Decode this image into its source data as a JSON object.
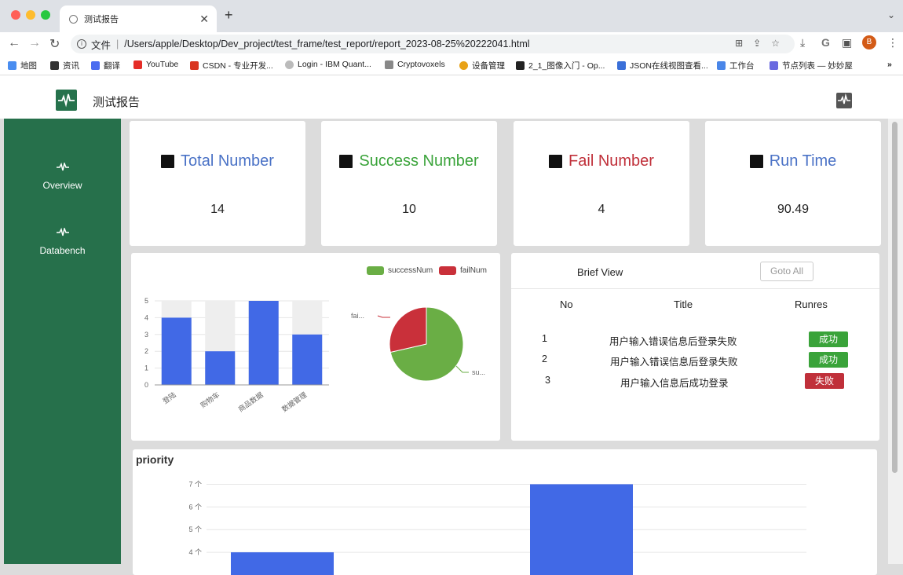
{
  "browser": {
    "tab_title": "测试报告",
    "url_prefix": "文件",
    "url": "/Users/apple/Desktop/Dev_project/test_frame/test_report/report_2023-08-25%20222041.html",
    "avatar_letter": "B",
    "bookmarks": [
      "地图",
      "资讯",
      "翻译",
      "YouTube",
      "CSDN - 专业开发...",
      "Login - IBM Quant...",
      "Cryptovoxels",
      "设备管理",
      "2_1_图像入门 - Op...",
      "JSON在线视图查看...",
      "工作台",
      "节点列表 — 妙妙屋"
    ]
  },
  "header": {
    "title": "测试报告"
  },
  "sidebar": {
    "items": [
      {
        "label": "Overview"
      },
      {
        "label": "Databench"
      }
    ]
  },
  "stats": [
    {
      "label": "Total Number",
      "value": "14",
      "color": "#4a72c6"
    },
    {
      "label": "Success Number",
      "value": "10",
      "color": "#3aa33a"
    },
    {
      "label": "Fail Number",
      "value": "4",
      "color": "#c0303a"
    },
    {
      "label": "Run Time",
      "value": "90.49",
      "color": "#4a72c6"
    }
  ],
  "chart_data": [
    {
      "type": "bar",
      "categories": [
        "登陆",
        "购物车",
        "商品数据",
        "数据管理"
      ],
      "values": [
        4,
        2,
        5,
        3
      ],
      "background_max": 5,
      "ylim": [
        0,
        5
      ],
      "yticks": [
        "0",
        "1",
        "2",
        "3",
        "4",
        "5"
      ],
      "colors": {
        "bar": "#4169e6",
        "background": "#eeeeee"
      }
    },
    {
      "type": "pie",
      "legend": [
        "successNum",
        "failNum"
      ],
      "slice_labels": [
        "fai...",
        "su..."
      ],
      "values": [
        {
          "name": "successNum",
          "value": 10
        },
        {
          "name": "failNum",
          "value": 4
        }
      ],
      "colors": {
        "successNum": "#6aae45",
        "failNum": "#c9303a"
      }
    },
    {
      "type": "bar",
      "title": "priority",
      "yticks": [
        "4 个",
        "5 个",
        "6 个",
        "7 个"
      ],
      "ylim": [
        3,
        7.5
      ],
      "values": [
        4,
        7
      ],
      "colors": {
        "bar": "#4169e6"
      }
    }
  ],
  "brief_view": {
    "title": "Brief View",
    "goto_label": "Goto All",
    "columns": [
      "No",
      "Title",
      "Runres"
    ],
    "rows": [
      {
        "no": "1",
        "title": "用户输入错误信息后登录失败",
        "res": "成功",
        "ok": true
      },
      {
        "no": "2",
        "title": "用户输入错误信息后登录失败",
        "res": "成功",
        "ok": true
      },
      {
        "no": "3",
        "title": "用户输入信息后成功登录",
        "res": "失败",
        "ok": false
      }
    ]
  }
}
